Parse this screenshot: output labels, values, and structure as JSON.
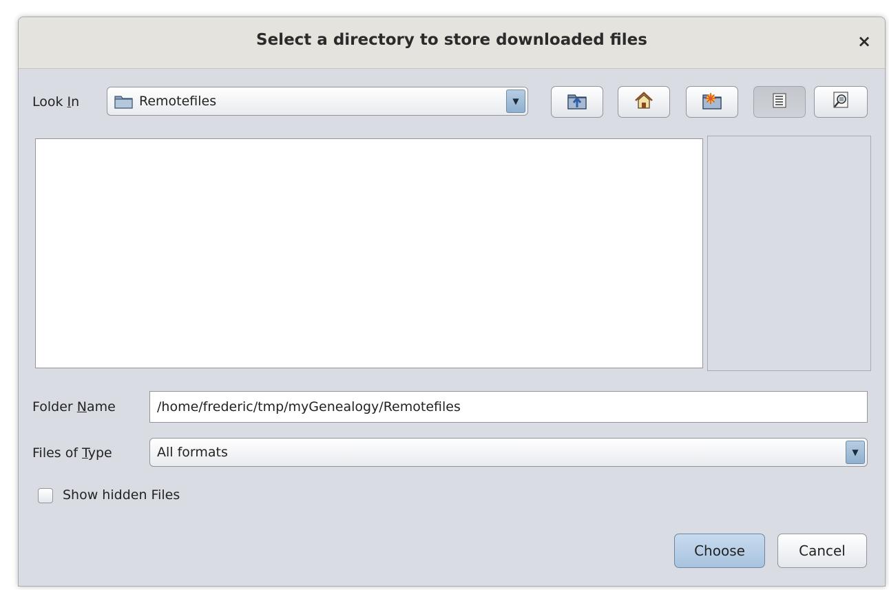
{
  "dialog": {
    "title": "Select a directory to store downloaded files",
    "close_glyph": "×"
  },
  "look_in": {
    "label_pre": "Look ",
    "label_mnemonic": "I",
    "label_post": "n",
    "value": "Remotefiles",
    "icon": "folder-icon"
  },
  "toolbar": [
    {
      "name": "up-one-level-button",
      "icon": "folder-up-icon"
    },
    {
      "name": "home-button",
      "icon": "home-icon"
    },
    {
      "name": "new-folder-button",
      "icon": "new-folder-icon"
    },
    {
      "name": "list-view-button",
      "icon": "list-view-icon",
      "pressed": true
    },
    {
      "name": "details-view-button",
      "icon": "details-view-icon"
    }
  ],
  "folder_name": {
    "label_pre": "Folder ",
    "label_mnemonic": "N",
    "label_post": "ame",
    "value": "/home/frederic/tmp/myGenealogy/Remotefiles"
  },
  "files_of_type": {
    "label_pre": "Files of ",
    "label_mnemonic": "T",
    "label_post": "ype",
    "value": "All formats"
  },
  "show_hidden": {
    "label": "Show hidden Files",
    "checked": false
  },
  "buttons": {
    "choose": "Choose",
    "cancel": "Cancel"
  },
  "colors": {
    "dialog_bg": "#d9dce3",
    "titlebar_bg": "#e5e3dd",
    "default_button": "#b8cfe7"
  }
}
